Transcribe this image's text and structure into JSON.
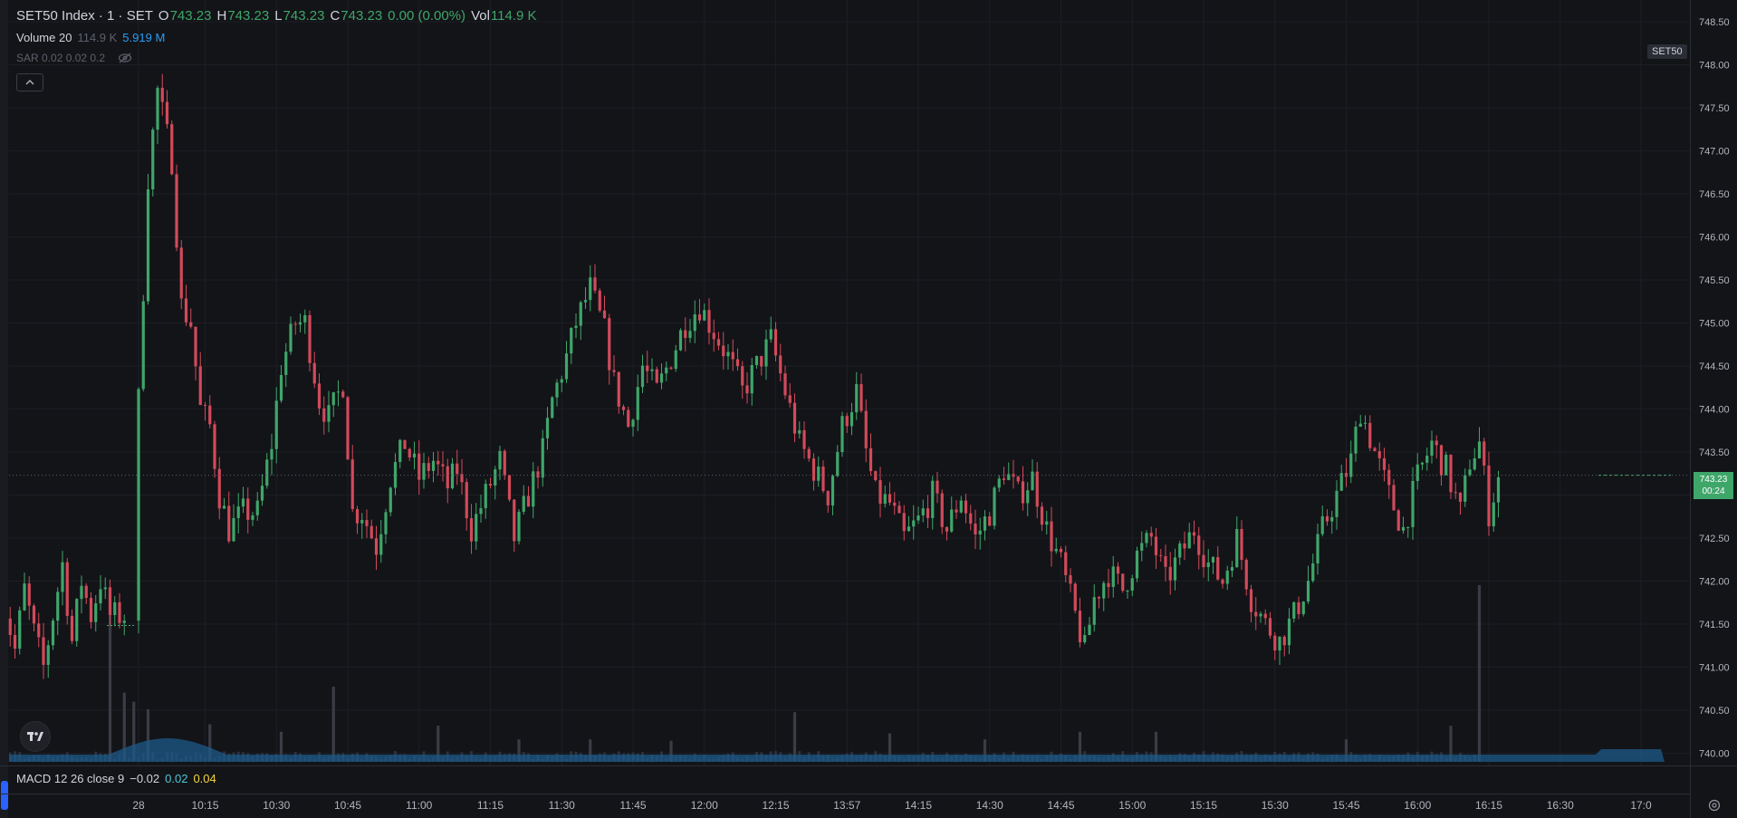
{
  "legend": {
    "symbol": "SET50 Index · 1 · SET",
    "open_label": "O",
    "open": "743.23",
    "high_label": "H",
    "high": "743.23",
    "low_label": "L",
    "low": "743.23",
    "close_label": "C",
    "close": "743.23",
    "change": "0.00 (0.00%)",
    "vol_label": "Vol",
    "vol": "114.9 K",
    "volume_indicator": "Volume 20",
    "volume_value": "114.9 K",
    "volume_ma": "5.919 M",
    "sar": "SAR 0.02 0.02 0.2",
    "macd": "MACD 12 26 close 9",
    "macd_v1": "−0.02",
    "macd_v2": "0.02",
    "macd_v3": "0.04"
  },
  "badges": {
    "set50": "SET50",
    "price": "743.23",
    "countdown": "00:24"
  },
  "icons": {
    "collapse": "chevron-up-icon",
    "visibility": "eye-off-icon",
    "logo": "tradingview-logo-icon",
    "settings": "settings-icon"
  },
  "colors": {
    "up": "#3fa66a",
    "down": "#d24a5a",
    "volume_ma": "#1d5a8a",
    "background": "#131418"
  },
  "chart_data": {
    "type": "candlestick",
    "symbol": "SET50",
    "y_axis": {
      "min": 739.9,
      "max": 748.7,
      "ticks": [
        "748.50",
        "748.00",
        "747.50",
        "747.00",
        "746.50",
        "746.00",
        "745.50",
        "745.00",
        "744.50",
        "744.00",
        "743.50",
        "743.00",
        "742.50",
        "742.00",
        "741.50",
        "741.00",
        "740.50",
        "740.00"
      ]
    },
    "x_axis": {
      "ticks": [
        {
          "label": "28",
          "i": 0
        },
        {
          "label": "10:15",
          "i": 14
        },
        {
          "label": "10:30",
          "i": 29
        },
        {
          "label": "10:45",
          "i": 44
        },
        {
          "label": "11:00",
          "i": 59
        },
        {
          "label": "11:15",
          "i": 74
        },
        {
          "label": "11:30",
          "i": 89
        },
        {
          "label": "11:45",
          "i": 104
        },
        {
          "label": "12:00",
          "i": 119
        },
        {
          "label": "12:15",
          "i": 134
        },
        {
          "label": "13:57",
          "i": 149
        },
        {
          "label": "14:15",
          "i": 164
        },
        {
          "label": "14:30",
          "i": 179
        },
        {
          "label": "14:45",
          "i": 194
        },
        {
          "label": "15:00",
          "i": 209
        },
        {
          "label": "15:15",
          "i": 224
        },
        {
          "label": "15:30",
          "i": 239
        },
        {
          "label": "15:45",
          "i": 254
        },
        {
          "label": "16:00",
          "i": 269
        },
        {
          "label": "16:15",
          "i": 284
        },
        {
          "label": "16:30",
          "i": 299
        },
        {
          "label": "17:0",
          "i": 316
        }
      ],
      "count": 318
    },
    "last_price": 743.23,
    "grid": true,
    "anchors": [
      [
        -29,
        741.9
      ],
      [
        -26,
        741.2
      ],
      [
        -24,
        741.9
      ],
      [
        -22,
        741.4
      ],
      [
        -20,
        741.0
      ],
      [
        -18,
        741.6
      ],
      [
        -16,
        742.2
      ],
      [
        -14,
        741.3
      ],
      [
        -12,
        742.0
      ],
      [
        -10,
        741.6
      ],
      [
        -8,
        742.0
      ],
      [
        -6,
        741.6
      ],
      [
        -3,
        741.6
      ],
      [
        -1,
        741.6
      ],
      [
        0,
        744.1
      ],
      [
        2,
        746.7
      ],
      [
        4,
        747.7
      ],
      [
        7,
        746.9
      ],
      [
        9,
        745.2
      ],
      [
        11,
        745.0
      ],
      [
        13,
        744.0
      ],
      [
        15,
        743.8
      ],
      [
        17,
        743.0
      ],
      [
        19,
        742.6
      ],
      [
        22,
        742.8
      ],
      [
        25,
        742.8
      ],
      [
        28,
        743.6
      ],
      [
        30,
        744.5
      ],
      [
        33,
        745.0
      ],
      [
        35,
        745.0
      ],
      [
        38,
        744.1
      ],
      [
        40,
        743.9
      ],
      [
        43,
        744.3
      ],
      [
        45,
        742.8
      ],
      [
        47,
        742.8
      ],
      [
        50,
        742.4
      ],
      [
        53,
        743.2
      ],
      [
        56,
        743.6
      ],
      [
        59,
        743.2
      ],
      [
        62,
        743.4
      ],
      [
        65,
        743.1
      ],
      [
        67,
        743.3
      ],
      [
        70,
        742.6
      ],
      [
        73,
        743.0
      ],
      [
        76,
        743.4
      ],
      [
        79,
        742.5
      ],
      [
        82,
        743.0
      ],
      [
        85,
        743.5
      ],
      [
        87,
        744.1
      ],
      [
        90,
        744.6
      ],
      [
        92,
        745.0
      ],
      [
        95,
        745.4
      ],
      [
        98,
        744.9
      ],
      [
        100,
        744.3
      ],
      [
        103,
        743.8
      ],
      [
        106,
        744.5
      ],
      [
        109,
        744.2
      ],
      [
        112,
        744.6
      ],
      [
        115,
        745.0
      ],
      [
        118,
        745.2
      ],
      [
        121,
        744.9
      ],
      [
        124,
        744.6
      ],
      [
        127,
        744.2
      ],
      [
        130,
        744.5
      ],
      [
        133,
        744.8
      ],
      [
        136,
        744.2
      ],
      [
        139,
        743.6
      ],
      [
        142,
        743.3
      ],
      [
        145,
        743.0
      ],
      [
        148,
        743.8
      ],
      [
        151,
        744.2
      ],
      [
        153,
        743.5
      ],
      [
        155,
        743.0
      ],
      [
        158,
        742.9
      ],
      [
        161,
        742.5
      ],
      [
        164,
        742.7
      ],
      [
        167,
        743.0
      ],
      [
        170,
        742.6
      ],
      [
        173,
        743.0
      ],
      [
        176,
        742.5
      ],
      [
        179,
        742.8
      ],
      [
        182,
        743.3
      ],
      [
        185,
        743.0
      ],
      [
        188,
        743.2
      ],
      [
        191,
        742.6
      ],
      [
        194,
        742.2
      ],
      [
        197,
        741.6
      ],
      [
        199,
        741.2
      ],
      [
        201,
        741.8
      ],
      [
        204,
        742.1
      ],
      [
        207,
        741.9
      ],
      [
        210,
        742.3
      ],
      [
        213,
        742.5
      ],
      [
        216,
        742.0
      ],
      [
        219,
        742.3
      ],
      [
        222,
        742.6
      ],
      [
        225,
        742.2
      ],
      [
        228,
        742.0
      ],
      [
        231,
        742.5
      ],
      [
        234,
        741.8
      ],
      [
        237,
        741.5
      ],
      [
        240,
        741.3
      ],
      [
        243,
        741.6
      ],
      [
        246,
        742.0
      ],
      [
        249,
        742.6
      ],
      [
        252,
        743.0
      ],
      [
        255,
        743.4
      ],
      [
        257,
        744.0
      ],
      [
        260,
        743.5
      ],
      [
        263,
        743.0
      ],
      [
        266,
        742.6
      ],
      [
        269,
        743.2
      ],
      [
        272,
        743.6
      ],
      [
        275,
        743.3
      ],
      [
        278,
        742.8
      ],
      [
        280,
        743.4
      ],
      [
        282,
        743.6
      ],
      [
        284,
        742.8
      ],
      [
        286,
        743.2
      ]
    ],
    "volume_spikes": [
      [
        -6,
        220
      ],
      [
        -3,
        92
      ],
      [
        -1,
        80
      ],
      [
        2,
        70
      ],
      [
        15,
        50
      ],
      [
        30,
        40
      ],
      [
        41,
        100
      ],
      [
        63,
        48
      ],
      [
        80,
        30
      ],
      [
        95,
        30
      ],
      [
        112,
        28
      ],
      [
        138,
        66
      ],
      [
        158,
        38
      ],
      [
        178,
        30
      ],
      [
        198,
        40
      ],
      [
        214,
        40
      ],
      [
        254,
        30
      ],
      [
        276,
        48
      ],
      [
        282,
        235
      ]
    ],
    "volume_spike_unit": "K"
  }
}
